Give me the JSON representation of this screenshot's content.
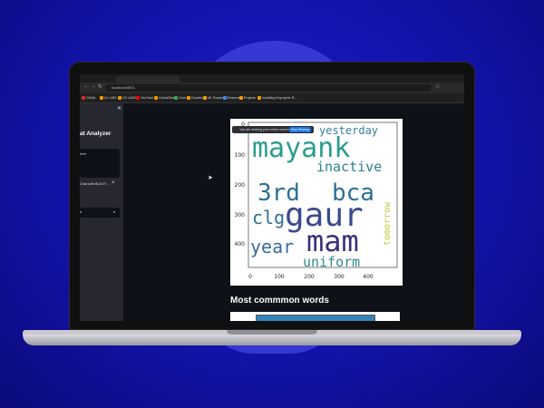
{
  "browser": {
    "url": "localhost:8501",
    "tab_title": "streamlit",
    "bookmarks": [
      {
        "label": "GMAIL",
        "color": "#d93025"
      },
      {
        "label": "AI LABS",
        "color": "#f29900"
      },
      {
        "label": "VS LABS",
        "color": "#f29900"
      },
      {
        "label": "YouTube",
        "color": "#ff0000"
      },
      {
        "label": "GlobalShala",
        "color": "#f29900"
      },
      {
        "label": "Drive",
        "color": "#34a853"
      },
      {
        "label": "Doubtnut",
        "color": "#f29900"
      },
      {
        "label": "ML Roadmap",
        "color": "#f29900"
      },
      {
        "label": "Resume",
        "color": "#4285f4"
      },
      {
        "label": "Projects",
        "color": "#f29900"
      },
      {
        "label": "Installing Keyrapher R...",
        "color": "#f29900"
      }
    ]
  },
  "sidebar": {
    "close_icon": "close-icon",
    "title": "at Analyzer",
    "upload_label": "here",
    "file_name": "Chat with BCA FI...",
    "select_value": "a"
  },
  "share_banner": {
    "text": "You are sharing your entire screen.",
    "button": "Stop Sharing"
  },
  "chart_data": {
    "type": "wordcloud",
    "words": [
      {
        "text": "mayank",
        "color": "#2a9d8f",
        "weight": 10
      },
      {
        "text": "gaur",
        "color": "#3b4a8c",
        "weight": 10
      },
      {
        "text": "mam",
        "color": "#3b2f7a",
        "weight": 10
      },
      {
        "text": "3rd",
        "color": "#2e6f95",
        "weight": 7
      },
      {
        "text": "bca",
        "color": "#2e6f95",
        "weight": 7
      },
      {
        "text": "year",
        "color": "#3a6aa0",
        "weight": 5
      },
      {
        "text": "clg",
        "color": "#2e6f95",
        "weight": 5
      },
      {
        "text": "inactive",
        "color": "#2c7f8e",
        "weight": 4
      },
      {
        "text": "uniform",
        "color": "#2c8b8a",
        "weight": 4
      },
      {
        "text": "yesterday",
        "color": "#3a7fa2",
        "weight": 3
      },
      {
        "text": "tomorrow",
        "color": "#c2c93a",
        "weight": 2
      }
    ],
    "x_ticks": [
      "0",
      "100",
      "200",
      "300",
      "400"
    ],
    "y_ticks": [
      "0",
      "100",
      "200",
      "300",
      "400"
    ]
  },
  "section": {
    "most_common_title": "Most commmon words"
  }
}
